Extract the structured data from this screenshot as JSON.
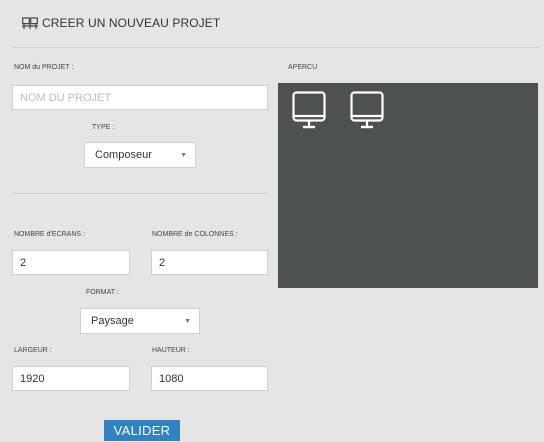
{
  "header": {
    "title": "CREER UN NOUVEAU PROJET",
    "icon": "screens-icon"
  },
  "form": {
    "project_name_label": "NOM du PROJET :",
    "project_name_placeholder": "NOM DU PROJET",
    "project_name_value": "",
    "type_label": "TYPE :",
    "type_value": "Composeur",
    "screens_label": "NOMBRE d'ECRANS :",
    "screens_value": "2",
    "columns_label": "NOMBRE de COLONNES :",
    "columns_value": "2",
    "format_label": "FORMAT :",
    "format_value": "Paysage",
    "width_label": "LARGEUR :",
    "width_value": "1920",
    "height_label": "HAUTEUR :",
    "height_value": "1080",
    "submit_label": "VALIDER"
  },
  "preview": {
    "label": "APERCU",
    "screen_count": 2,
    "background": "#4d5151"
  },
  "colors": {
    "accent": "#2f83c1",
    "page_bg": "#e5e5e5"
  }
}
